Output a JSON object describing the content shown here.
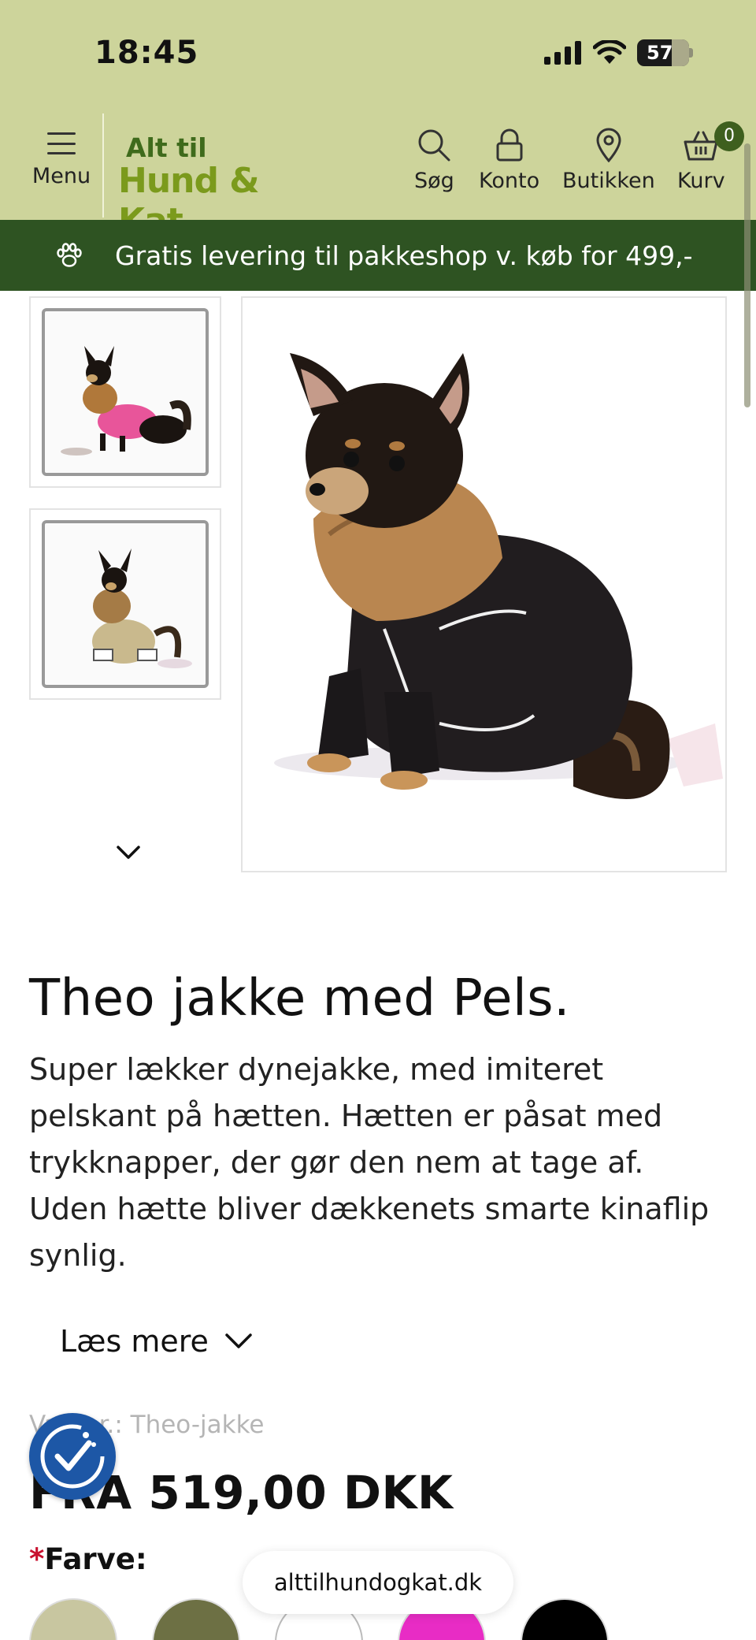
{
  "status_bar": {
    "time": "18:45",
    "battery": "57"
  },
  "header": {
    "menu_label": "Menu",
    "logo_line1": "Alt til",
    "logo_line2": "Hund & Kat",
    "nav": [
      {
        "label": "Søg",
        "icon": "search-icon"
      },
      {
        "label": "Konto",
        "icon": "lock-icon"
      },
      {
        "label": "Butikken",
        "icon": "location-pin-icon"
      },
      {
        "label": "Kurv",
        "icon": "basket-icon"
      }
    ],
    "cart_count": "0"
  },
  "promo": {
    "text": "Gratis levering til pakkeshop v. køb for 499,-",
    "icon": "paw-icon"
  },
  "gallery": {
    "thumbnails": [
      {
        "alt": "Chihuahua in pink jacket",
        "color": "#e8559a"
      },
      {
        "alt": "Chihuahua in beige jacket",
        "color": "#c9b98d"
      }
    ],
    "main_alt": "Chihuahua wearing black Theo jacket with fur collar"
  },
  "product": {
    "title": "Theo jakke med Pels.",
    "description": "Super lækker dynejakke, med imiteret pelskant på hætten. Hætten er påsat med trykknapper, der gør den nem at tage af. Uden hætte bliver dækkenets smarte kinaflip synlig.",
    "read_more": "Læs mere",
    "sku": "Varenr.: Theo-jakke",
    "price": "FRA 519,00 DKK",
    "color_required": "*",
    "color_label": "Farve:",
    "swatches": [
      "#c8c6a0",
      "#6d7044",
      "#ffffff",
      "#e82cc5",
      "#000000"
    ]
  },
  "browser": {
    "url": "alttilhundogkat.dk"
  },
  "colors": {
    "header_bg": "#cdd49b",
    "promo_bg": "#2e5322",
    "accessibility": "#1d57a6"
  }
}
